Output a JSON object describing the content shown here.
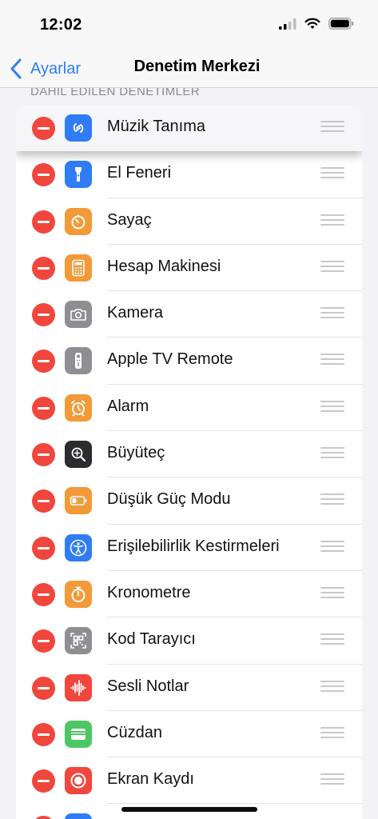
{
  "status_bar": {
    "time": "12:02",
    "icons": [
      "cellular-signal-icon",
      "wifi-icon",
      "battery-icon"
    ]
  },
  "nav": {
    "back_label": "Ayarlar",
    "title": "Denetim Merkezi"
  },
  "section": {
    "header": "DAHİL EDİLEN DENETİMLER"
  },
  "colors": {
    "accent": "#2f7cf6",
    "delete": "#f0463d"
  },
  "controls": [
    {
      "label": "Müzik Tanıma",
      "icon": "shazam-icon",
      "icon_color": "#2f7cf6",
      "lifted": true
    },
    {
      "label": "El Feneri",
      "icon": "flashlight-icon",
      "icon_color": "#2f7cf6"
    },
    {
      "label": "Sayaç",
      "icon": "timer-icon",
      "icon_color": "#f29a38"
    },
    {
      "label": "Hesap Makinesi",
      "icon": "calculator-icon",
      "icon_color": "#f29a38"
    },
    {
      "label": "Kamera",
      "icon": "camera-icon",
      "icon_color": "#8e8e93"
    },
    {
      "label": "Apple TV Remote",
      "icon": "tv-remote-icon",
      "icon_color": "#8e8e93"
    },
    {
      "label": "Alarm",
      "icon": "alarm-icon",
      "icon_color": "#f29a38"
    },
    {
      "label": "Büyüteç",
      "icon": "magnifier-icon",
      "icon_color": "#2c2c2e"
    },
    {
      "label": "Düşük Güç Modu",
      "icon": "low-power-icon",
      "icon_color": "#f29a38"
    },
    {
      "label": "Erişilebilirlik Kestirmeleri",
      "icon": "accessibility-icon",
      "icon_color": "#2f7cf6"
    },
    {
      "label": "Kronometre",
      "icon": "stopwatch-icon",
      "icon_color": "#f29a38"
    },
    {
      "label": "Kod Tarayıcı",
      "icon": "qr-code-icon",
      "icon_color": "#8e8e93"
    },
    {
      "label": "Sesli Notlar",
      "icon": "voice-memo-icon",
      "icon_color": "#f0463d"
    },
    {
      "label": "Cüzdan",
      "icon": "wallet-icon",
      "icon_color": "#4cc764"
    },
    {
      "label": "Ekran Kaydı",
      "icon": "screen-record-icon",
      "icon_color": "#f0463d"
    },
    {
      "label": "",
      "icon": "partial-row-icon",
      "icon_color": "#2f7cf6"
    }
  ]
}
